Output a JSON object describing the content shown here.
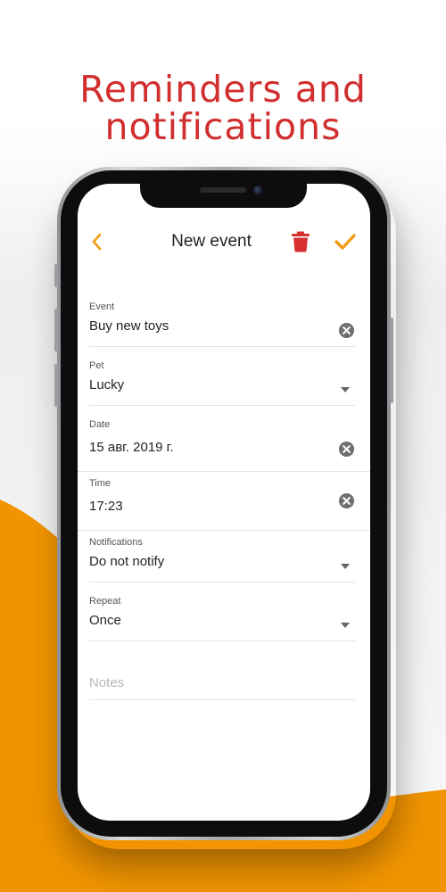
{
  "headline": {
    "line1": "Reminders and",
    "line2": "notifications"
  },
  "colors": {
    "accent": "#f39c12",
    "headline": "#d12f2f",
    "trash": "#d63031",
    "orange_bg": "#f19400"
  },
  "header": {
    "title": "New event",
    "back_icon": "chevron-left-icon",
    "delete_icon": "trash-icon",
    "confirm_icon": "check-icon"
  },
  "form": {
    "event": {
      "label": "Event",
      "value": "Buy new toys"
    },
    "pet": {
      "label": "Pet",
      "value": "Lucky"
    },
    "date": {
      "label": "Date",
      "value": "15 авг. 2019 г."
    },
    "time": {
      "label": "Time",
      "value": "17:23"
    },
    "notifications": {
      "label": "Notifications",
      "value": "Do not notify"
    },
    "repeat": {
      "label": "Repeat",
      "value": "Once"
    },
    "notes": {
      "placeholder": "Notes",
      "value": ""
    }
  }
}
